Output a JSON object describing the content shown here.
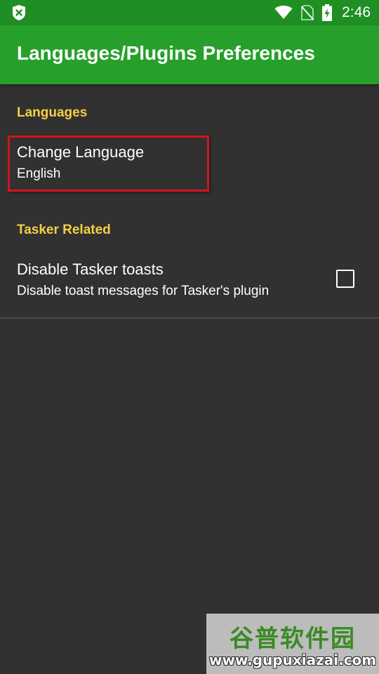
{
  "status_bar": {
    "time": "2:46",
    "left_icon": "app-notification-icon",
    "icons": [
      "wifi-icon",
      "no-sim-icon",
      "battery-charging-icon"
    ]
  },
  "app_bar": {
    "title": "Languages/Plugins Preferences"
  },
  "sections": [
    {
      "category": "Languages",
      "items": [
        {
          "title": "Change Language",
          "summary": "English"
        }
      ]
    },
    {
      "category": "Tasker Related",
      "items": [
        {
          "title": "Disable Tasker toasts",
          "summary": "Disable toast messages for Tasker's plugin",
          "checked": false
        }
      ]
    }
  ],
  "watermark": {
    "chinese": "谷普软件园",
    "url": "www.gupuxiazai.com"
  },
  "colors": {
    "status_bar": "#1f8f24",
    "app_bar": "#26a02b",
    "background": "#313131",
    "category_text": "#f4cf45",
    "highlight_border": "#d3141d"
  }
}
